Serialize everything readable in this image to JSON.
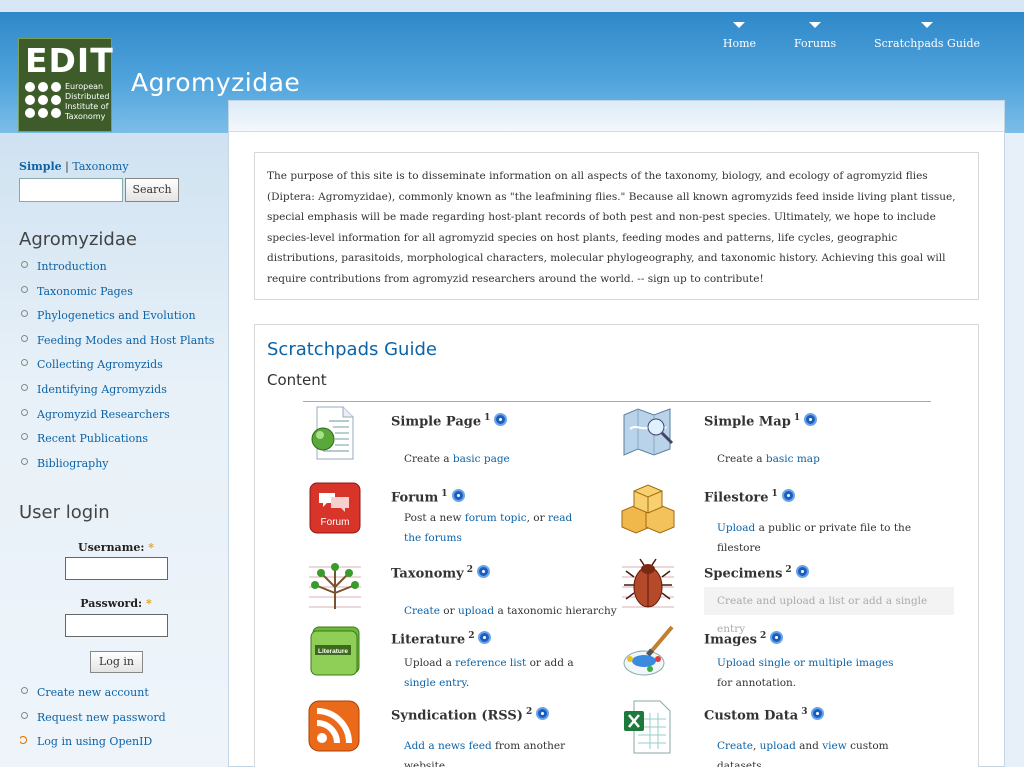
{
  "header": {
    "logo": {
      "big": "EDIT",
      "small": "European Distributed Institute of Taxonomy"
    },
    "site_name": "Agromyzidae",
    "nav": [
      "Home",
      "Forums",
      "Scratchpads Guide"
    ]
  },
  "sidebar": {
    "search": {
      "tab_simple": "Simple",
      "separator": "|",
      "tab_taxonomy": "Taxonomy",
      "button": "Search",
      "value": ""
    },
    "menu_title": "Agromyzidae",
    "menu": [
      "Introduction",
      "Taxonomic Pages",
      "Phylogenetics and Evolution",
      "Feeding Modes and Host Plants",
      "Collecting Agromyzids",
      "Identifying Agromyzids",
      "Agromyzid Researchers",
      "Recent Publications",
      "Bibliography"
    ],
    "login": {
      "title": "User login",
      "username_label": "Username:",
      "password_label": "Password:",
      "required": "*",
      "button": "Log in",
      "links": [
        "Create new account",
        "Request new password",
        "Log in using OpenID"
      ]
    }
  },
  "main": {
    "intro": "The purpose of this site is to disseminate information on all aspects of the taxonomy, biology, and ecology of agromyzid flies (Diptera: Agromyzidae), commonly known as \"the leafmining flies.\" Because all known agromyzids feed inside living plant tissue, special emphasis will be made regarding host-plant records of both pest and non-pest species. Ultimately, we hope to include species-level information for all agromyzid species on host plants, feeding modes and patterns, life cycles, geographic distributions, parasitoids, morphological characters, molecular phylogeography, and taxonomic history. Achieving this goal will require contributions from agromyzid researchers around the world. -- sign up to contribute!",
    "guide_title": "Scratchpads Guide",
    "content_title": "Content",
    "items": [
      {
        "title": "Simple Page",
        "sup": "1",
        "d": [
          "Create a ",
          "basic page"
        ]
      },
      {
        "title": "Simple Map",
        "sup": "1",
        "d": [
          "Create a ",
          "basic map"
        ]
      },
      {
        "title": "Forum",
        "sup": "1",
        "icon_text": "Forum",
        "d": [
          "Post a new ",
          "forum topic",
          ", or ",
          "read the forums"
        ]
      },
      {
        "title": "Filestore",
        "sup": "1",
        "d": [
          "Upload",
          " a public or private file to the filestore"
        ]
      },
      {
        "title": "Taxonomy",
        "sup": "2",
        "d": [
          "Create",
          " or ",
          "upload",
          " a taxonomic hierarchy"
        ]
      },
      {
        "title": "Specimens",
        "sup": "2",
        "d": [
          "Create and upload a list or add a single entry"
        ]
      },
      {
        "title": "Literature",
        "sup": "2",
        "icon_text": "Literature",
        "d": [
          "Upload a ",
          "reference list",
          " or add a ",
          "single entry",
          "."
        ]
      },
      {
        "title": "Images",
        "sup": "2",
        "d": [
          "Upload single or multiple images",
          " for annotation."
        ]
      },
      {
        "title": "Syndication (RSS)",
        "sup": "2",
        "d": [
          "Add a news feed",
          " from another website"
        ]
      },
      {
        "title": "Custom Data",
        "sup": "3",
        "d": [
          "Create",
          ", ",
          "upload",
          " and ",
          "view",
          " custom datasets."
        ]
      }
    ]
  }
}
